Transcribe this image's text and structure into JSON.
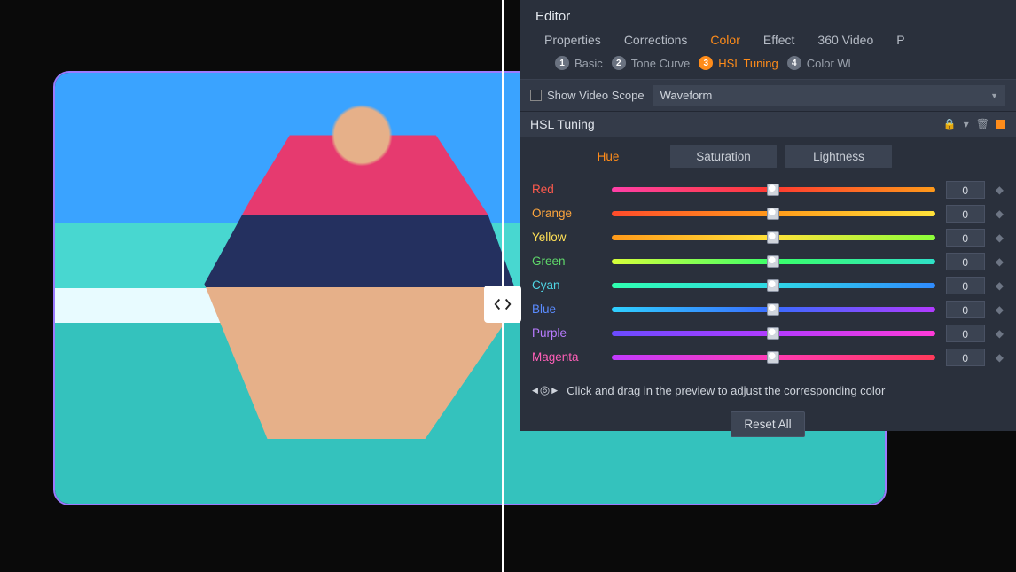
{
  "editor": {
    "title": "Editor",
    "tabs": [
      "Properties",
      "Corrections",
      "Color",
      "Effect",
      "360 Video",
      "P"
    ],
    "active_tab": 2,
    "subtabs": [
      {
        "n": "1",
        "label": "Basic"
      },
      {
        "n": "2",
        "label": "Tone Curve"
      },
      {
        "n": "3",
        "label": "HSL Tuning"
      },
      {
        "n": "4",
        "label": "Color Wl"
      }
    ],
    "active_subtab": 2,
    "scope_checkbox_label": "Show Video Scope",
    "scope_select": "Waveform"
  },
  "hsl": {
    "section_title": "HSL Tuning",
    "tabs": [
      "Hue",
      "Saturation",
      "Lightness"
    ],
    "active": 0,
    "rows": [
      {
        "label": "Red",
        "cls": "c-red",
        "grad": "linear-gradient(90deg,#ff3fa7,#ff3b30,#ff9a1a)",
        "value": "0"
      },
      {
        "label": "Orange",
        "cls": "c-orange",
        "grad": "linear-gradient(90deg,#ff4b2b,#ff9a1a,#ffe23a)",
        "value": "0"
      },
      {
        "label": "Yellow",
        "cls": "c-yellow",
        "grad": "linear-gradient(90deg,#ff9a1a,#ffe23a,#8bff3a)",
        "value": "0"
      },
      {
        "label": "Green",
        "cls": "c-green",
        "grad": "linear-gradient(90deg,#d7ff3a,#3aff6a,#2fe0c7)",
        "value": "0"
      },
      {
        "label": "Cyan",
        "cls": "c-cyan",
        "grad": "linear-gradient(90deg,#2fffb0,#2fd7e6,#2f8bff)",
        "value": "0"
      },
      {
        "label": "Blue",
        "cls": "c-blue",
        "grad": "linear-gradient(90deg,#2fd0ff,#3a6bff,#b23aff)",
        "value": "0"
      },
      {
        "label": "Purple",
        "cls": "c-purple",
        "grad": "linear-gradient(90deg,#6a4bff,#b23aff,#ff3ad7)",
        "value": "0"
      },
      {
        "label": "Magenta",
        "cls": "c-magenta",
        "grad": "linear-gradient(90deg,#c23aff,#ff3ab2,#ff3a5a)",
        "value": "0"
      }
    ],
    "hint": "Click and drag in the preview to adjust the corresponding color",
    "reset": "Reset All"
  }
}
